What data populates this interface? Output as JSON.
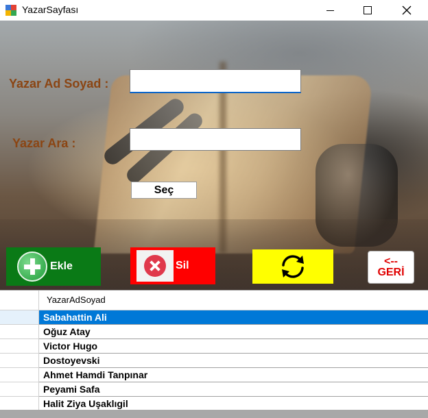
{
  "window": {
    "title": "YazarSayfası"
  },
  "form": {
    "name_label": "Yazar Ad Soyad :",
    "name_value": "",
    "search_label": "Yazar Ara :",
    "search_value": "",
    "select_button": "Seç"
  },
  "buttons": {
    "add_label": "Ekle",
    "delete_label": "Sil",
    "refresh_icon": "refresh-icon",
    "back_arrow": "<--",
    "back_label": "GERİ"
  },
  "colors": {
    "label": "#8b4513",
    "add_bg": "#0a7a16",
    "delete_bg": "#ff0000",
    "refresh_bg": "#ffff00",
    "back_text": "#e00000",
    "selection": "#0078d7"
  },
  "grid": {
    "column_header": "YazarAdSoyad",
    "selected_index": 0,
    "rows": [
      "Sabahattin Ali",
      "Oğuz Atay",
      "Victor Hugo",
      "Dostoyevski",
      "Ahmet Hamdi Tanpınar",
      "Peyami Safa",
      "Halit Ziya Uşaklıgil"
    ]
  }
}
